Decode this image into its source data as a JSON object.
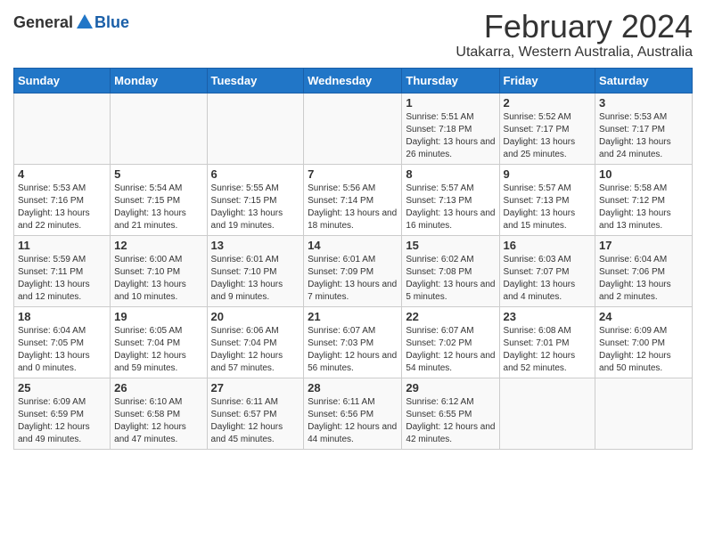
{
  "header": {
    "logo_general": "General",
    "logo_blue": "Blue",
    "month_title": "February 2024",
    "location": "Utakarra, Western Australia, Australia"
  },
  "weekdays": [
    "Sunday",
    "Monday",
    "Tuesday",
    "Wednesday",
    "Thursday",
    "Friday",
    "Saturday"
  ],
  "weeks": [
    [
      {
        "day": "",
        "info": ""
      },
      {
        "day": "",
        "info": ""
      },
      {
        "day": "",
        "info": ""
      },
      {
        "day": "",
        "info": ""
      },
      {
        "day": "1",
        "info": "Sunrise: 5:51 AM\nSunset: 7:18 PM\nDaylight: 13 hours\nand 26 minutes."
      },
      {
        "day": "2",
        "info": "Sunrise: 5:52 AM\nSunset: 7:17 PM\nDaylight: 13 hours\nand 25 minutes."
      },
      {
        "day": "3",
        "info": "Sunrise: 5:53 AM\nSunset: 7:17 PM\nDaylight: 13 hours\nand 24 minutes."
      }
    ],
    [
      {
        "day": "4",
        "info": "Sunrise: 5:53 AM\nSunset: 7:16 PM\nDaylight: 13 hours\nand 22 minutes."
      },
      {
        "day": "5",
        "info": "Sunrise: 5:54 AM\nSunset: 7:15 PM\nDaylight: 13 hours\nand 21 minutes."
      },
      {
        "day": "6",
        "info": "Sunrise: 5:55 AM\nSunset: 7:15 PM\nDaylight: 13 hours\nand 19 minutes."
      },
      {
        "day": "7",
        "info": "Sunrise: 5:56 AM\nSunset: 7:14 PM\nDaylight: 13 hours\nand 18 minutes."
      },
      {
        "day": "8",
        "info": "Sunrise: 5:57 AM\nSunset: 7:13 PM\nDaylight: 13 hours\nand 16 minutes."
      },
      {
        "day": "9",
        "info": "Sunrise: 5:57 AM\nSunset: 7:13 PM\nDaylight: 13 hours\nand 15 minutes."
      },
      {
        "day": "10",
        "info": "Sunrise: 5:58 AM\nSunset: 7:12 PM\nDaylight: 13 hours\nand 13 minutes."
      }
    ],
    [
      {
        "day": "11",
        "info": "Sunrise: 5:59 AM\nSunset: 7:11 PM\nDaylight: 13 hours\nand 12 minutes."
      },
      {
        "day": "12",
        "info": "Sunrise: 6:00 AM\nSunset: 7:10 PM\nDaylight: 13 hours\nand 10 minutes."
      },
      {
        "day": "13",
        "info": "Sunrise: 6:01 AM\nSunset: 7:10 PM\nDaylight: 13 hours\nand 9 minutes."
      },
      {
        "day": "14",
        "info": "Sunrise: 6:01 AM\nSunset: 7:09 PM\nDaylight: 13 hours\nand 7 minutes."
      },
      {
        "day": "15",
        "info": "Sunrise: 6:02 AM\nSunset: 7:08 PM\nDaylight: 13 hours\nand 5 minutes."
      },
      {
        "day": "16",
        "info": "Sunrise: 6:03 AM\nSunset: 7:07 PM\nDaylight: 13 hours\nand 4 minutes."
      },
      {
        "day": "17",
        "info": "Sunrise: 6:04 AM\nSunset: 7:06 PM\nDaylight: 13 hours\nand 2 minutes."
      }
    ],
    [
      {
        "day": "18",
        "info": "Sunrise: 6:04 AM\nSunset: 7:05 PM\nDaylight: 13 hours\nand 0 minutes."
      },
      {
        "day": "19",
        "info": "Sunrise: 6:05 AM\nSunset: 7:04 PM\nDaylight: 12 hours\nand 59 minutes."
      },
      {
        "day": "20",
        "info": "Sunrise: 6:06 AM\nSunset: 7:04 PM\nDaylight: 12 hours\nand 57 minutes."
      },
      {
        "day": "21",
        "info": "Sunrise: 6:07 AM\nSunset: 7:03 PM\nDaylight: 12 hours\nand 56 minutes."
      },
      {
        "day": "22",
        "info": "Sunrise: 6:07 AM\nSunset: 7:02 PM\nDaylight: 12 hours\nand 54 minutes."
      },
      {
        "day": "23",
        "info": "Sunrise: 6:08 AM\nSunset: 7:01 PM\nDaylight: 12 hours\nand 52 minutes."
      },
      {
        "day": "24",
        "info": "Sunrise: 6:09 AM\nSunset: 7:00 PM\nDaylight: 12 hours\nand 50 minutes."
      }
    ],
    [
      {
        "day": "25",
        "info": "Sunrise: 6:09 AM\nSunset: 6:59 PM\nDaylight: 12 hours\nand 49 minutes."
      },
      {
        "day": "26",
        "info": "Sunrise: 6:10 AM\nSunset: 6:58 PM\nDaylight: 12 hours\nand 47 minutes."
      },
      {
        "day": "27",
        "info": "Sunrise: 6:11 AM\nSunset: 6:57 PM\nDaylight: 12 hours\nand 45 minutes."
      },
      {
        "day": "28",
        "info": "Sunrise: 6:11 AM\nSunset: 6:56 PM\nDaylight: 12 hours\nand 44 minutes."
      },
      {
        "day": "29",
        "info": "Sunrise: 6:12 AM\nSunset: 6:55 PM\nDaylight: 12 hours\nand 42 minutes."
      },
      {
        "day": "",
        "info": ""
      },
      {
        "day": "",
        "info": ""
      }
    ]
  ]
}
